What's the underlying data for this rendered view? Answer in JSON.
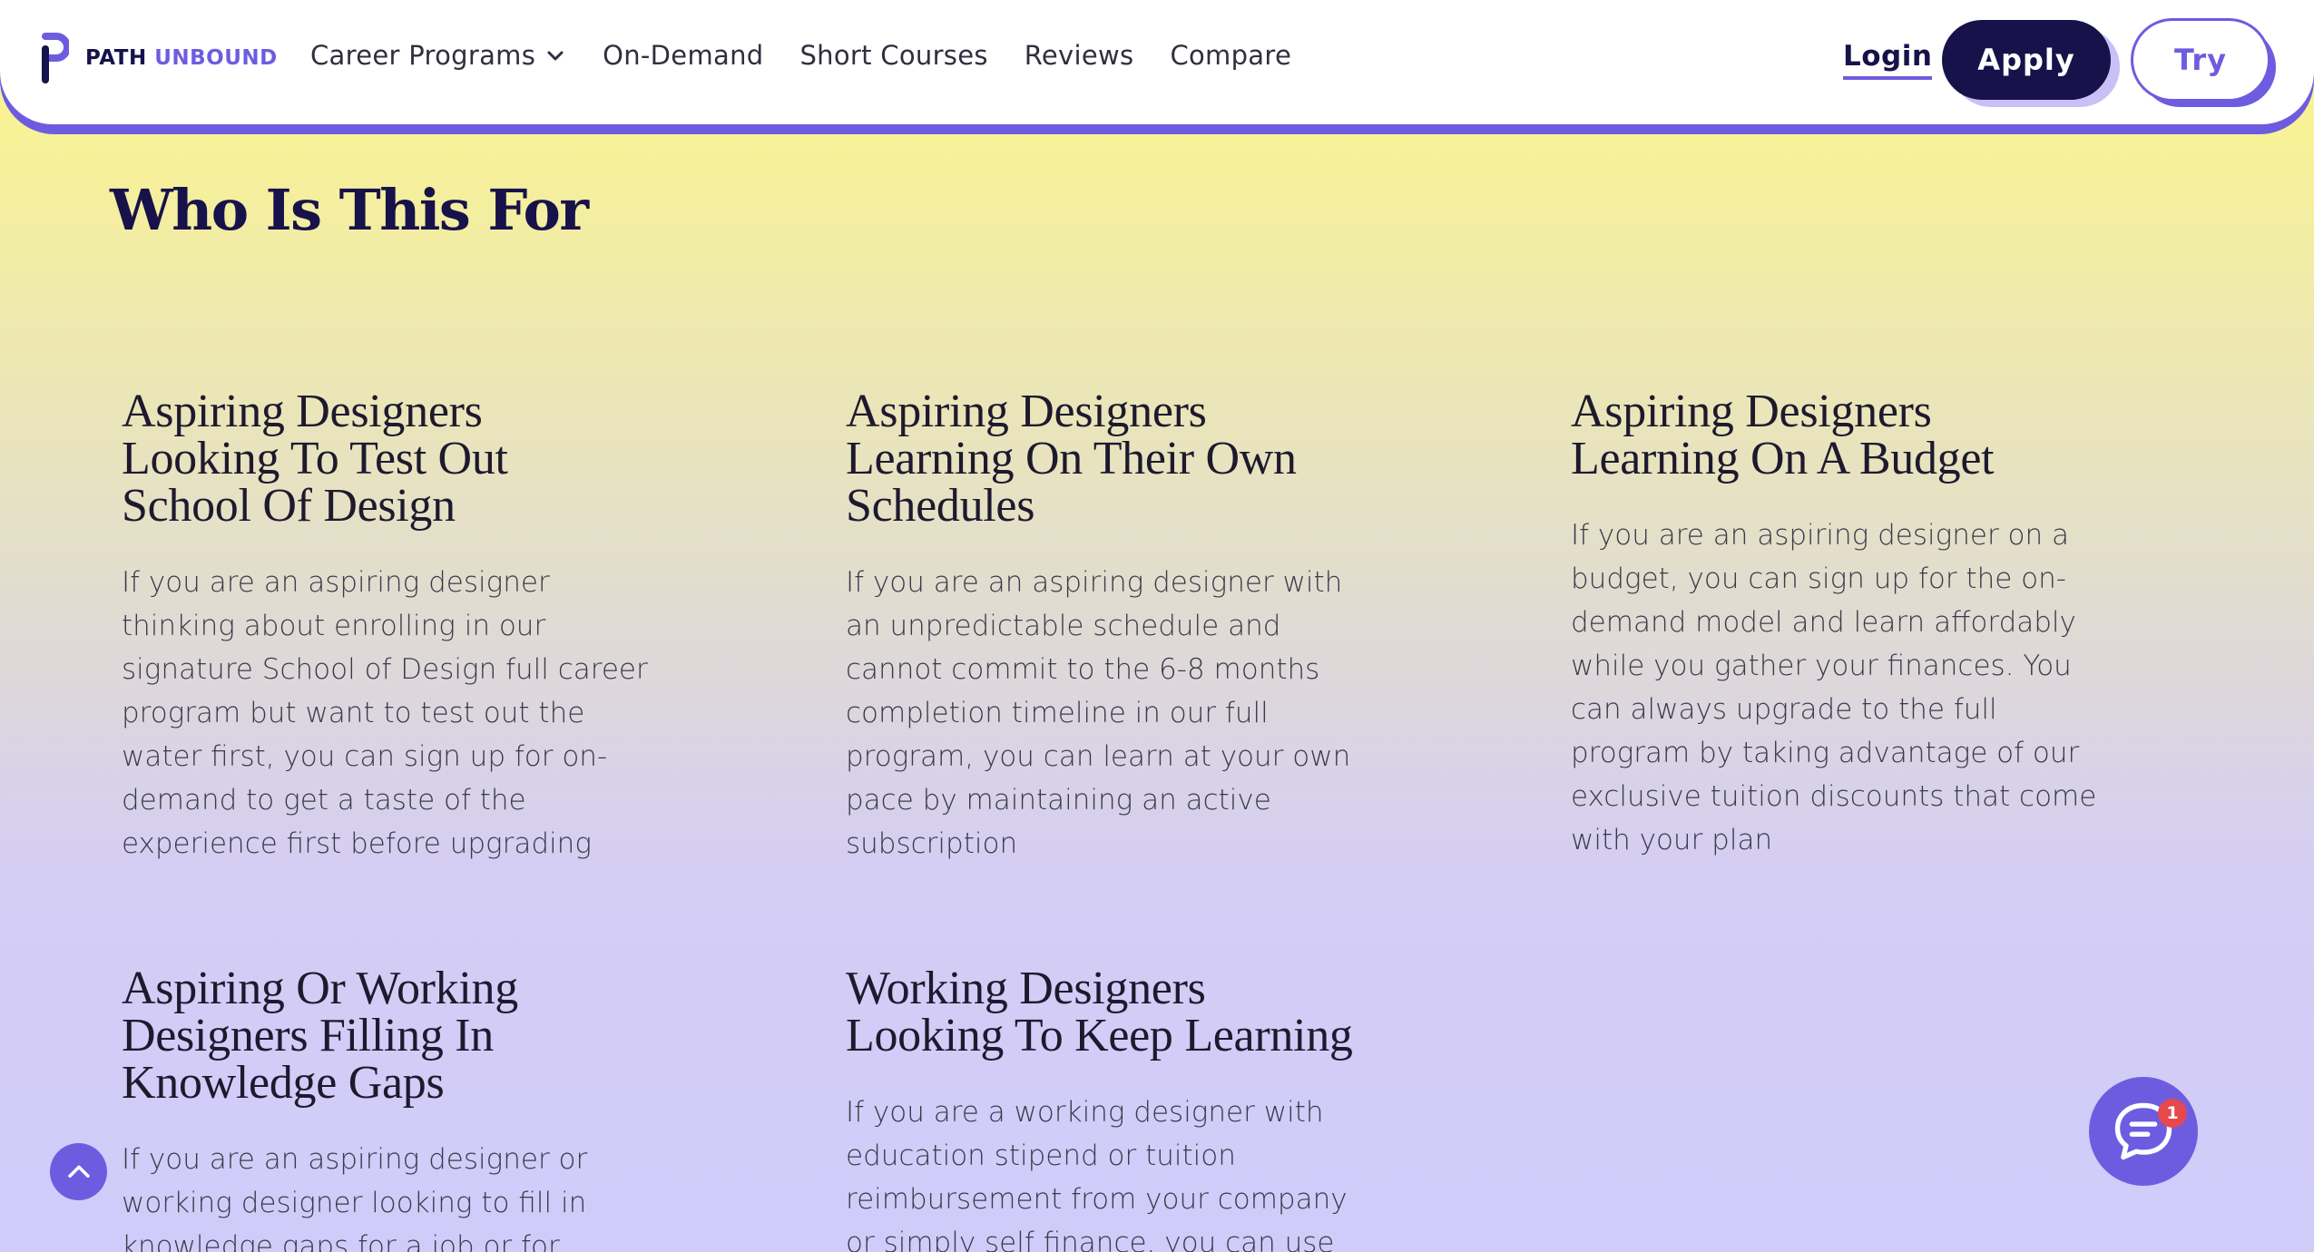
{
  "header": {
    "logo": {
      "word1": "PATH",
      "word2": "UNBOUND",
      "icon": "path-unbound-logo-icon"
    },
    "nav": [
      {
        "label": "Career Programs",
        "has_dropdown": true
      },
      {
        "label": "On-Demand"
      },
      {
        "label": "Short Courses"
      },
      {
        "label": "Reviews"
      },
      {
        "label": "Compare"
      }
    ],
    "login_label": "Login",
    "apply_label": "Apply",
    "try_label": "Try"
  },
  "main": {
    "section_title": "Who Is This For",
    "cards": [
      {
        "title": "Aspiring Designers Looking To Test Out School Of Design",
        "body": "If you are an aspiring designer thinking about enrolling in our signature School of Design full career program but want to test out the water first, you can sign up for on-demand to get a taste of the experience first before upgrading"
      },
      {
        "title": "Aspiring Designers Learning On Their Own Schedules",
        "body": "If you are an aspiring designer with an unpredictable schedule and cannot commit to the 6-8 months completion timeline in our full program, you can learn at your own pace by maintaining an active subscription"
      },
      {
        "title": "Aspiring Designers Learning On A Budget",
        "body": "If you are an aspiring designer on a budget, you can sign up for the on-demand model and learn affordably while you gather your finances. You can always upgrade to the full program by taking advantage of our exclusive tuition discounts that come with your plan"
      },
      {
        "title": "Aspiring Or Working Designers Filling In Knowledge Gaps",
        "body": "If you are an aspiring designer or working designer looking to fill in knowledge gaps for a job or for another"
      },
      {
        "title": "Working Designers Looking To Keep Learning",
        "body": "If you are a working designer with education stipend or tuition reimbursement from your company or simply self finance, you can use our on-"
      }
    ]
  },
  "widgets": {
    "scroll_top_icon": "chevron-up-icon",
    "chat_icon": "chat-bubble-icon",
    "chat_badge_count": "1"
  },
  "colors": {
    "brand_purple": "#6e5ce0",
    "brand_navy": "#17124a",
    "badge_red": "#e5484d"
  }
}
